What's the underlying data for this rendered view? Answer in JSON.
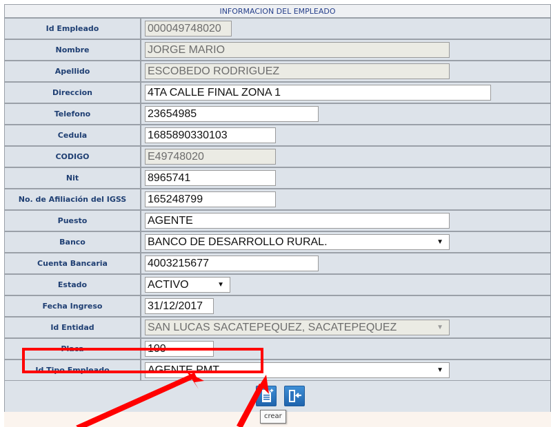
{
  "form": {
    "title": "INFORMACION DEL EMPLEADO",
    "fields": [
      {
        "label": "Id Empleado",
        "value": "000049748020"
      },
      {
        "label": "Nombre",
        "value": "JORGE MARIO"
      },
      {
        "label": "Apellido",
        "value": "ESCOBEDO RODRIGUEZ"
      },
      {
        "label": "Direccion",
        "value": "4TA CALLE FINAL ZONA 1"
      },
      {
        "label": "Telefono",
        "value": "23654985"
      },
      {
        "label": "Cedula",
        "value": "1685890330103"
      },
      {
        "label": "CODIGO",
        "value": "E49748020"
      },
      {
        "label": "Nit",
        "value": "8965741"
      },
      {
        "label": "No. de Afiliación del IGSS",
        "value": "165248799"
      },
      {
        "label": "Puesto",
        "value": "AGENTE"
      },
      {
        "label": "Banco",
        "value": "BANCO DE DESARROLLO RURAL."
      },
      {
        "label": "Cuenta Bancaria",
        "value": "4003215677"
      },
      {
        "label": "Estado",
        "value": "ACTIVO"
      },
      {
        "label": "Fecha Ingreso",
        "value": "31/12/2017"
      },
      {
        "label": "Id Entidad",
        "value": "SAN LUCAS SACATEPEQUEZ, SACATEPEQUEZ"
      },
      {
        "label": "Placa",
        "value": "100"
      },
      {
        "label": "Id Tipo Empleado",
        "value": "AGENTE PMT"
      }
    ]
  },
  "toolbar": {
    "create_icon": "new-document-icon",
    "exit_icon": "exit-door-icon",
    "tooltip": "crear"
  },
  "annotations": {
    "highlight_color": "#ff0000"
  }
}
